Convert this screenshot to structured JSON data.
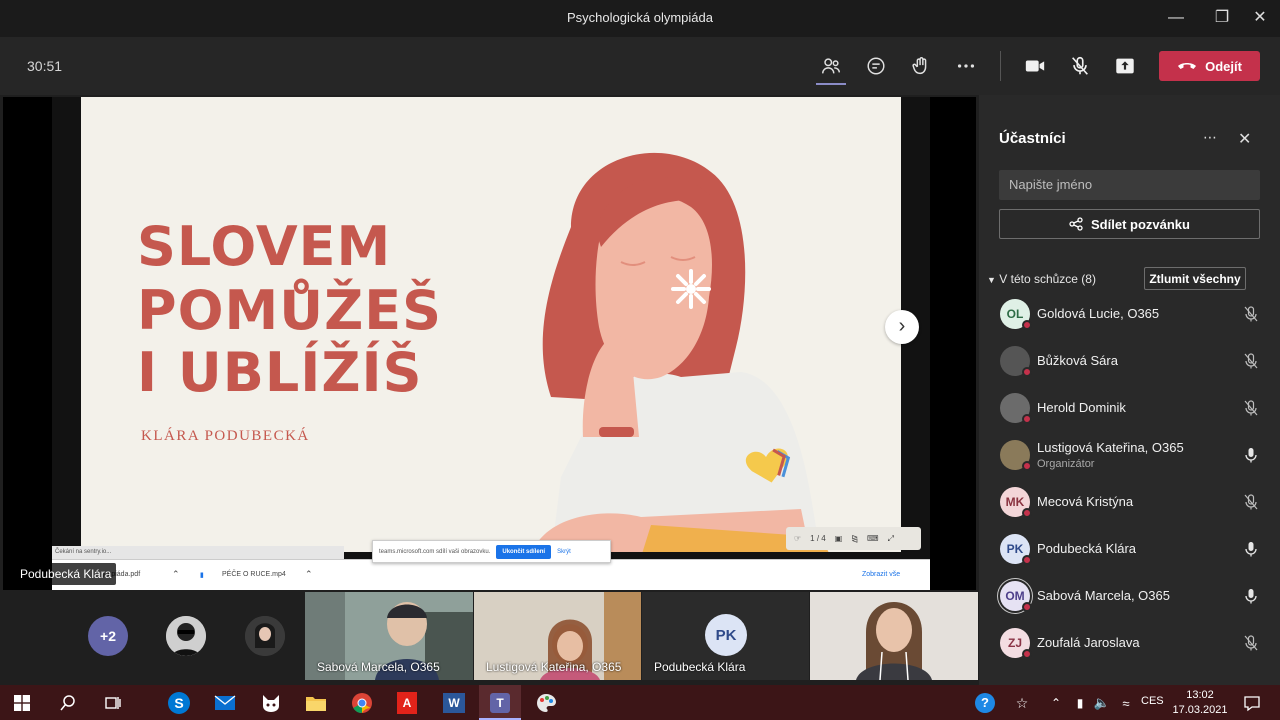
{
  "window": {
    "title": "Psychologická olympiáda"
  },
  "toolbar": {
    "timer": "30:51",
    "leave_label": "Odejít"
  },
  "slide": {
    "title_lines": [
      "SLOVEM",
      "POMŮŽEŠ",
      "I UBLÍŽÍŠ"
    ],
    "author": "KLÁRA PODUBECKÁ",
    "page_indicator": "1 / 4"
  },
  "browser": {
    "status_url": "Čekání na sentry.io...",
    "share_text": "teams.microsoft.com sdílí vaši obrazovku.",
    "stop_sharing": "Ukončit sdílení",
    "hide": "Skrýt",
    "downloads": [
      "ympiáda.pdf",
      "PÉČE O RUCE.mp4"
    ],
    "show_all": "Zobrazit vše"
  },
  "presenter_label": "Podubecká Klára",
  "gallery": {
    "overflow_count": "+2",
    "tiles": [
      {
        "name": "Sabová Marcela, O365"
      },
      {
        "name": "Lustigová Kateřina, O365"
      },
      {
        "name": "Podubecká Klára",
        "initials": "PK"
      },
      {
        "name": ""
      }
    ]
  },
  "panel": {
    "heading": "Účastníci",
    "search_placeholder": "Napište jméno",
    "invite_label": "Sdílet pozvánku",
    "meeting_header": "V této schůzce (8)",
    "mute_all": "Ztlumit všechny",
    "participants": [
      {
        "name": "Goldová Lucie, O365",
        "initials": "OL",
        "avatar_bg": "#dff0e6",
        "avatar_fg": "#2d6b45",
        "muted": true
      },
      {
        "name": "Bůžková Sára",
        "initials": "",
        "avatar_bg": "#555555",
        "avatar_fg": "#ffffff",
        "muted": true
      },
      {
        "name": "Herold Dominik",
        "initials": "",
        "avatar_bg": "#6b6b6b",
        "avatar_fg": "#ffffff",
        "muted": true
      },
      {
        "name": "Lustigová Kateřina, O365",
        "role": "Organizátor",
        "initials": "",
        "avatar_bg": "#8a7a5a",
        "avatar_fg": "#ffffff",
        "muted": false
      },
      {
        "name": "Mecová Kristýna",
        "initials": "MK",
        "avatar_bg": "#f3d6d8",
        "avatar_fg": "#8a3340",
        "muted": true
      },
      {
        "name": "Podubecká Klára",
        "initials": "PK",
        "avatar_bg": "#dce4f5",
        "avatar_fg": "#2f4a8a",
        "muted": false
      },
      {
        "name": "Sabová Marcela, O365",
        "initials": "OM",
        "avatar_bg": "#e6e2f3",
        "avatar_fg": "#4d3f8a",
        "muted": false
      },
      {
        "name": "Zoufalá Jaroslava",
        "initials": "ZJ",
        "avatar_bg": "#f3dde2",
        "avatar_fg": "#8a3346",
        "muted": true
      }
    ]
  },
  "taskbar": {
    "language": "CES",
    "time": "13:02",
    "date": "17.03.2021"
  },
  "colors": {
    "accent_leave": "#c4314b",
    "slide_text": "#c5584e",
    "teams_purple": "#6264a7"
  }
}
